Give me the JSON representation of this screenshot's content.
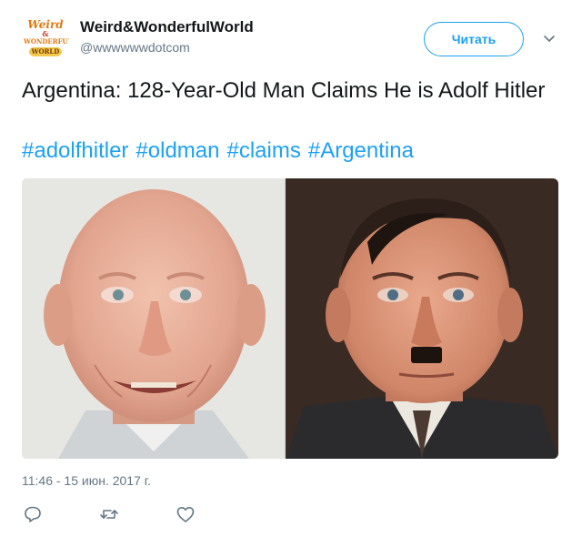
{
  "tweet": {
    "user": {
      "display_name": "Weird&WonderfulWorld",
      "handle": "@wwwwwwdotcom",
      "avatar_text": [
        "Weird",
        "&",
        "WONDERFUL",
        "WORLD"
      ]
    },
    "follow_button_label": "Читать",
    "text": "Argentina: 128-Year-Old Man Claims He is Adolf Hitler",
    "hashtags": [
      "#adolfhitler",
      "#oldman",
      "#claims",
      "#Argentina"
    ],
    "timestamp": "11:46 - 15 июн. 2017 г.",
    "icons": {
      "caret": "chevron-down-icon",
      "reply": "reply-icon",
      "retweet": "retweet-icon",
      "like": "heart-icon"
    },
    "colors": {
      "accent": "#1da1f2",
      "secondary_text": "#657786",
      "primary_text": "#14171a"
    }
  }
}
